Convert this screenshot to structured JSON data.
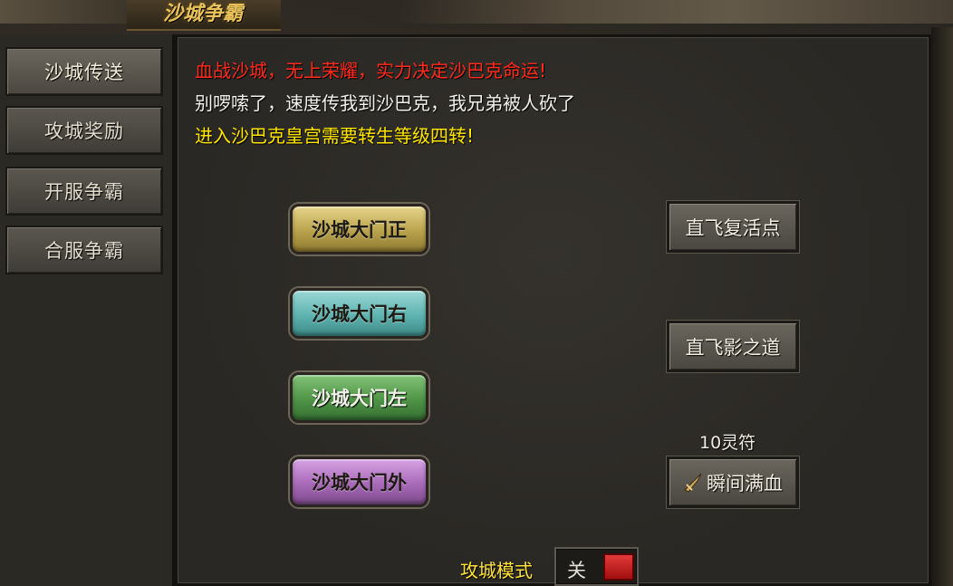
{
  "window": {
    "title": "沙城争霸"
  },
  "sidebar": {
    "items": [
      {
        "label": "沙城传送",
        "active": true
      },
      {
        "label": "攻城奖励",
        "active": false
      },
      {
        "label": "开服争霸",
        "active": false
      },
      {
        "label": "合服争霸",
        "active": false
      }
    ]
  },
  "messages": {
    "line1": "血战沙城，无上荣耀，实力决定沙巴克命运!",
    "line2": "别啰嗦了，速度传我到沙巴克，我兄弟被人砍了",
    "line3": "进入沙巴克皇宫需要转生等级四转!"
  },
  "gates": [
    {
      "label": "沙城大门正",
      "color": "#c9b45a"
    },
    {
      "label": "沙城大门右",
      "color": "#6fc0bd"
    },
    {
      "label": "沙城大门左",
      "color": "#5ea655"
    },
    {
      "label": "沙城大门外",
      "color": "#b37dc4"
    }
  ],
  "fly": {
    "revive_label": "直飞复活点",
    "shadow_label": "直飞影之道",
    "heal_label": "瞬间满血",
    "heal_cost": "10灵符",
    "heal_icon": "dagger-icon"
  },
  "siege_mode": {
    "label": "攻城模式",
    "state_text": "关",
    "on": false,
    "indicator_color": "#d42525"
  },
  "colors": {
    "message_red": "#ff2a1c",
    "message_white": "#f2f0ea",
    "message_yellow": "#ffe600",
    "title_gold": "#e8c15a"
  }
}
